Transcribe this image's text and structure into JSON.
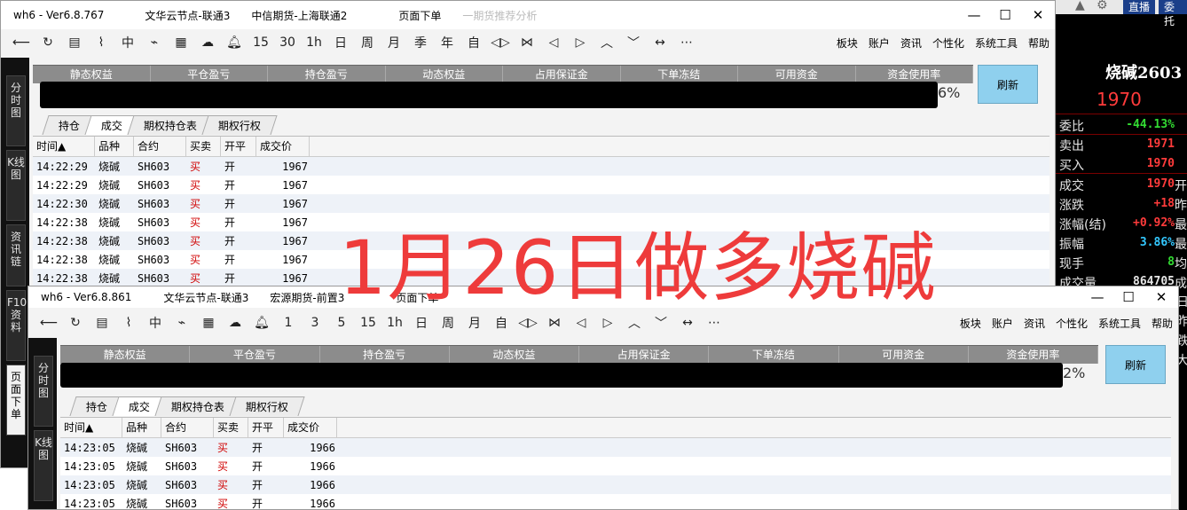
{
  "win1": {
    "title_segments": [
      "wh6 - Ver6.8.767",
      "文华云节点-联通3",
      "中信期货-上海联通2",
      "页面下单"
    ],
    "bg_fragment": "一期货推荐分析",
    "toolbar_icons": [
      "back-icon",
      "refresh-icon",
      "list-icon",
      "line-chart-icon",
      "candle-icon",
      "wave-icon",
      "grid-icon",
      "cloud-sync-icon",
      "bell-icon"
    ],
    "periods": [
      "15",
      "30",
      "1h",
      "日",
      "周",
      "月",
      "季",
      "年",
      "自"
    ],
    "nav_icons": [
      "‹›",
      "⋈",
      "◁",
      "▷",
      "︿",
      "﹀",
      "↔",
      "⋯"
    ],
    "menus": [
      "板块",
      "账户",
      "资讯",
      "个性化",
      "系统工具",
      "帮助"
    ],
    "sidebar": [
      "分时图",
      "K线图",
      "资讯链",
      "F10资料",
      "页面下单"
    ],
    "columns": [
      "静态权益",
      "平仓盈亏",
      "持仓盈亏",
      "动态权益",
      "占用保证金",
      "下单冻结",
      "可用资金",
      "资金使用率"
    ],
    "pct": "6%",
    "refresh": "刷新",
    "subtabs": [
      "持仓",
      "成交",
      "期权持仓表",
      "期权行权"
    ],
    "grid_headers": [
      "时间▲",
      "品种",
      "合约",
      "买卖",
      "开平",
      "成交价"
    ],
    "rows": [
      {
        "time": "14:22:29",
        "prod": "烧碱",
        "con": "SH603",
        "dir": "买",
        "kp": "开",
        "price": "1967"
      },
      {
        "time": "14:22:29",
        "prod": "烧碱",
        "con": "SH603",
        "dir": "买",
        "kp": "开",
        "price": "1967"
      },
      {
        "time": "14:22:30",
        "prod": "烧碱",
        "con": "SH603",
        "dir": "买",
        "kp": "开",
        "price": "1967"
      },
      {
        "time": "14:22:38",
        "prod": "烧碱",
        "con": "SH603",
        "dir": "买",
        "kp": "开",
        "price": "1967"
      },
      {
        "time": "14:22:38",
        "prod": "烧碱",
        "con": "SH603",
        "dir": "买",
        "kp": "开",
        "price": "1967"
      },
      {
        "time": "14:22:38",
        "prod": "烧碱",
        "con": "SH603",
        "dir": "买",
        "kp": "开",
        "price": "1967"
      },
      {
        "time": "14:22:38",
        "prod": "烧碱",
        "con": "SH603",
        "dir": "买",
        "kp": "开",
        "price": "1967"
      }
    ]
  },
  "win2": {
    "title_segments": [
      "wh6 - Ver6.8.861",
      "文华云节点-联通3",
      "宏源期货-前置3",
      "页面下单"
    ],
    "periods": [
      "1",
      "3",
      "5",
      "15",
      "1h",
      "日",
      "周",
      "月",
      "自"
    ],
    "menus": [
      "板块",
      "账户",
      "资讯",
      "个性化",
      "系统工具",
      "帮助"
    ],
    "sidebar": [
      "分时图",
      "K线图"
    ],
    "columns": [
      "静态权益",
      "平仓盈亏",
      "持仓盈亏",
      "动态权益",
      "占用保证金",
      "下单冻结",
      "可用资金",
      "资金使用率"
    ],
    "pct": "2%",
    "refresh": "刷新",
    "subtabs": [
      "持仓",
      "成交",
      "期权持仓表",
      "期权行权"
    ],
    "grid_headers": [
      "时间▲",
      "品种",
      "合约",
      "买卖",
      "开平",
      "成交价"
    ],
    "rows": [
      {
        "time": "14:23:05",
        "prod": "烧碱",
        "con": "SH603",
        "dir": "买",
        "kp": "开",
        "price": "1966"
      },
      {
        "time": "14:23:05",
        "prod": "烧碱",
        "con": "SH603",
        "dir": "买",
        "kp": "开",
        "price": "1966"
      },
      {
        "time": "14:23:05",
        "prod": "烧碱",
        "con": "SH603",
        "dir": "买",
        "kp": "开",
        "price": "1966"
      },
      {
        "time": "14:23:05",
        "prod": "烧碱",
        "con": "SH603",
        "dir": "买",
        "kp": "开",
        "price": "1966"
      }
    ]
  },
  "quote": {
    "buttons": [
      "直播",
      "委托"
    ],
    "name": "烧碱2603",
    "price": "1970",
    "rows": [
      {
        "label": "委比",
        "value": "-44.13%",
        "color": "#33dd33",
        "extra": ""
      },
      {
        "label": "卖出",
        "value": "1971",
        "color": "#ff3b3b",
        "extra": ""
      },
      {
        "label": "买入",
        "value": "1970",
        "color": "#ff3b3b",
        "extra": ""
      },
      {
        "label": "成交",
        "value": "1970",
        "color": "#ff3b3b",
        "extra": "开"
      },
      {
        "label": "涨跌",
        "value": "+18",
        "color": "#ff3b3b",
        "extra": "昨"
      },
      {
        "label": "涨幅(结)",
        "value": "+0.92%",
        "color": "#ff3b3b",
        "extra": "最"
      },
      {
        "label": "振幅",
        "value": "3.86%",
        "color": "#33c8ff",
        "extra": "最"
      },
      {
        "label": "现手",
        "value": "8",
        "color": "#33dd33",
        "extra": "均"
      },
      {
        "label": "成交量",
        "value": "864705",
        "color": "#e6e6e6",
        "extra": "成"
      }
    ],
    "right_chars": [
      "日",
      "昨",
      "跌",
      "大"
    ]
  },
  "overlay_text": "1月26日做多烧碱"
}
